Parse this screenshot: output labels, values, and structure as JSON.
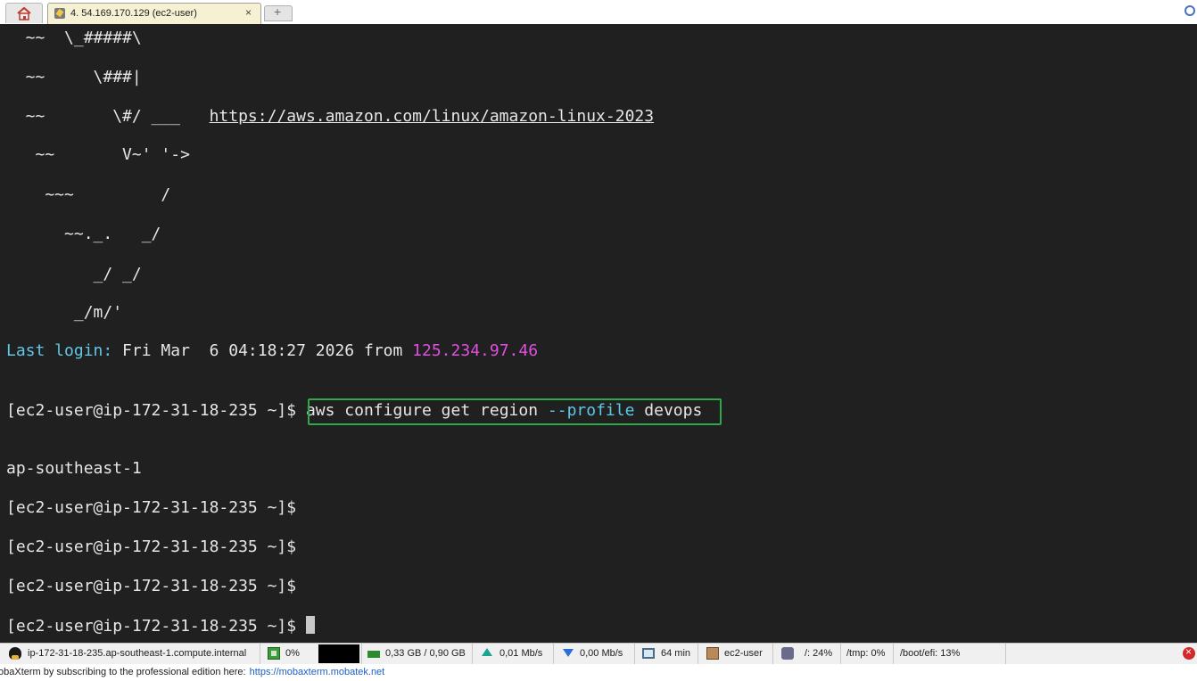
{
  "tabbar": {
    "session_tab_title": "4. 54.169.170.129 (ec2-user)",
    "close_glyph": "×",
    "new_tab_glyph": "+"
  },
  "terminal": {
    "ascii_lines": [
      "  ~~  \\_#####\\",
      "  ~~     \\###|",
      "  ~~       \\#/ ___   ",
      "   ~~       V~' '->",
      "    ~~~         /",
      "      ~~._.   _/",
      "         _/ _/",
      "       _/m/'"
    ],
    "url": "https://aws.amazon.com/linux/amazon-linux-2023",
    "last_login_label": "Last login:",
    "last_login_time": " Fri Mar  6 04:18:27 2026 from ",
    "last_login_ip": "125.234.97.46",
    "prompt": "[ec2-user@ip-172-31-18-235 ~]$ ",
    "command_part1": "aws configure get region ",
    "command_flag": "--profile",
    "command_part2": " devops",
    "output": "ap-southeast-1",
    "empty_prompt": "[ec2-user@ip-172-31-18-235 ~]$",
    "colors": {
      "background": "#202020",
      "text": "#e6e6e6",
      "cyan": "#5fc8e8",
      "magenta": "#e04fe0",
      "highlight_box": "#2fa84a"
    }
  },
  "statusbar": {
    "host": "ip-172-31-18-235.ap-southeast-1.compute.internal",
    "cpu": "0%",
    "memory": "0,33 GB / 0,90 GB",
    "upload": "0,01 Mb/s",
    "download": "0,00 Mb/s",
    "uptime": "64 min",
    "user": "ec2-user",
    "disk_root": "/: 24%",
    "disk_tmp": "/tmp: 0%",
    "disk_boot": "/boot/efi: 13%"
  },
  "infobar": {
    "message": "obaXterm by subscribing to the professional edition here:",
    "link": "https://mobaxterm.mobatek.net"
  }
}
